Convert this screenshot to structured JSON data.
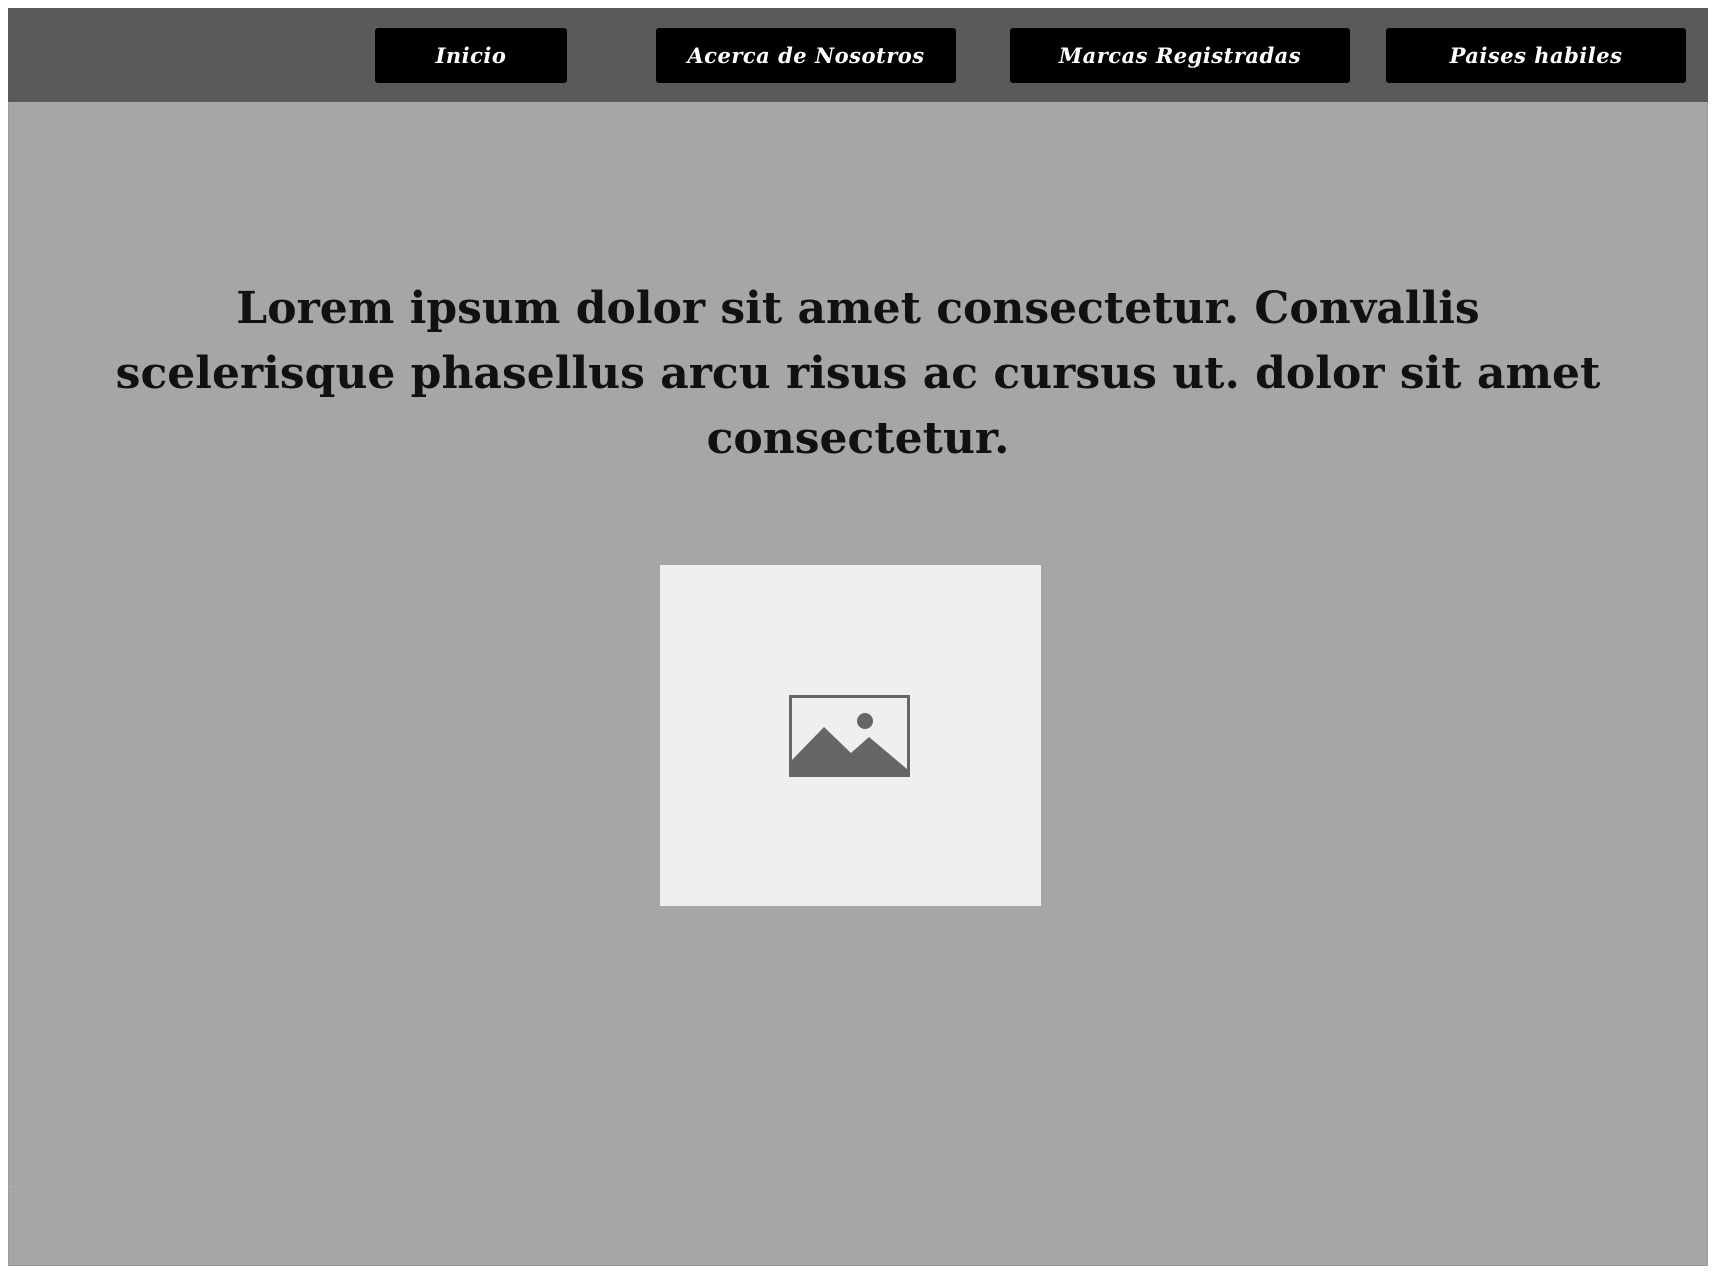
{
  "nav": {
    "items": [
      {
        "label": "Inicio"
      },
      {
        "label": "Acerca de Nosotros"
      },
      {
        "label": "Marcas Registradas"
      },
      {
        "label": "Paises habiles"
      }
    ]
  },
  "hero": {
    "text": "Lorem ipsum dolor sit amet consectetur. Convallis scelerisque phasellus arcu risus ac cursus ut. dolor sit amet consectetur."
  },
  "media": {
    "icon": "image-icon"
  },
  "colors": {
    "page_background": "#a6a6a6",
    "navbar_background": "#5a5a5a",
    "button_background": "#000000",
    "button_text": "#ffffff",
    "placeholder_background": "#efefef",
    "icon_color": "#666666"
  }
}
